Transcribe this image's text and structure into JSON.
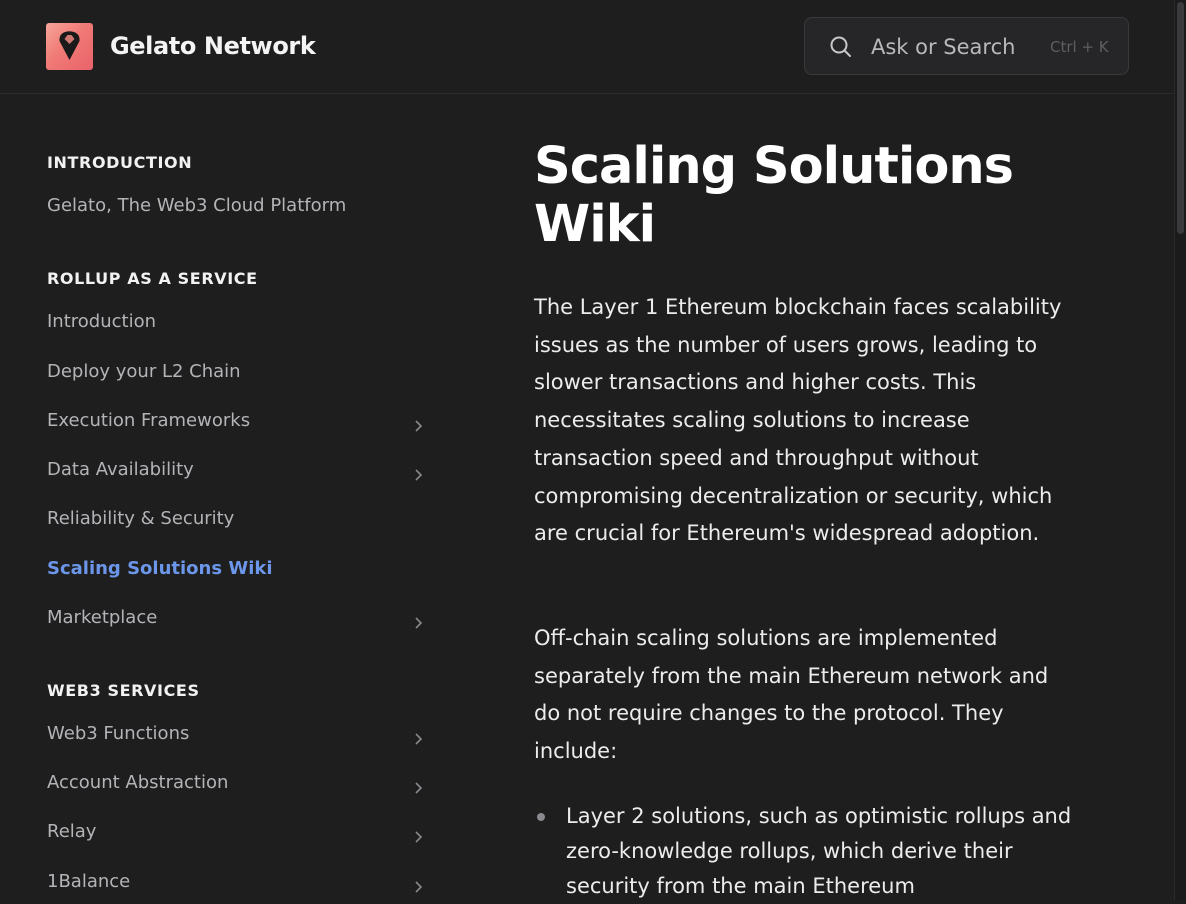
{
  "header": {
    "brand": "Gelato Network",
    "logo_icon": "gelato-logo-icon",
    "search": {
      "placeholder": "Ask or Search",
      "shortcut": "Ctrl + K"
    }
  },
  "sidebar": {
    "sections": [
      {
        "heading": "INTRODUCTION",
        "items": [
          {
            "label": "Gelato, The Web3 Cloud Platform",
            "has_children": false,
            "active": false
          }
        ]
      },
      {
        "heading": "ROLLUP AS A SERVICE",
        "items": [
          {
            "label": "Introduction",
            "has_children": false,
            "active": false
          },
          {
            "label": "Deploy your L2 Chain",
            "has_children": false,
            "active": false
          },
          {
            "label": "Execution Frameworks",
            "has_children": true,
            "active": false
          },
          {
            "label": "Data Availability",
            "has_children": true,
            "active": false
          },
          {
            "label": "Reliability & Security",
            "has_children": false,
            "active": false
          },
          {
            "label": "Scaling Solutions Wiki",
            "has_children": false,
            "active": true
          },
          {
            "label": "Marketplace",
            "has_children": true,
            "active": false
          }
        ]
      },
      {
        "heading": "WEB3 SERVICES",
        "items": [
          {
            "label": "Web3 Functions",
            "has_children": true,
            "active": false
          },
          {
            "label": "Account Abstraction",
            "has_children": true,
            "active": false
          },
          {
            "label": "Relay",
            "has_children": true,
            "active": false
          },
          {
            "label": "1Balance",
            "has_children": true,
            "active": false
          }
        ]
      }
    ]
  },
  "content": {
    "title": "Scaling Solutions Wiki",
    "paragraphs": [
      "The Layer 1 Ethereum blockchain faces scalability issues as the number of users grows, leading to slower transactions and higher costs. This necessitates scaling solutions to increase transaction speed and throughput without compromising decentralization or security, which are crucial for Ethereum's widespread adoption.",
      "Off-chain scaling solutions are implemented separately from the main Ethereum network and do not require changes to the protocol. They include:"
    ],
    "bullets": [
      "Layer 2 solutions, such as optimistic rollups and zero-knowledge rollups, which derive their security from the main Ethereum"
    ]
  },
  "colors": {
    "background": "#1e1e1f",
    "accent_active": "#6b96e9",
    "logo_gradient_start": "#f6a59a",
    "logo_gradient_end": "#e9636a"
  }
}
